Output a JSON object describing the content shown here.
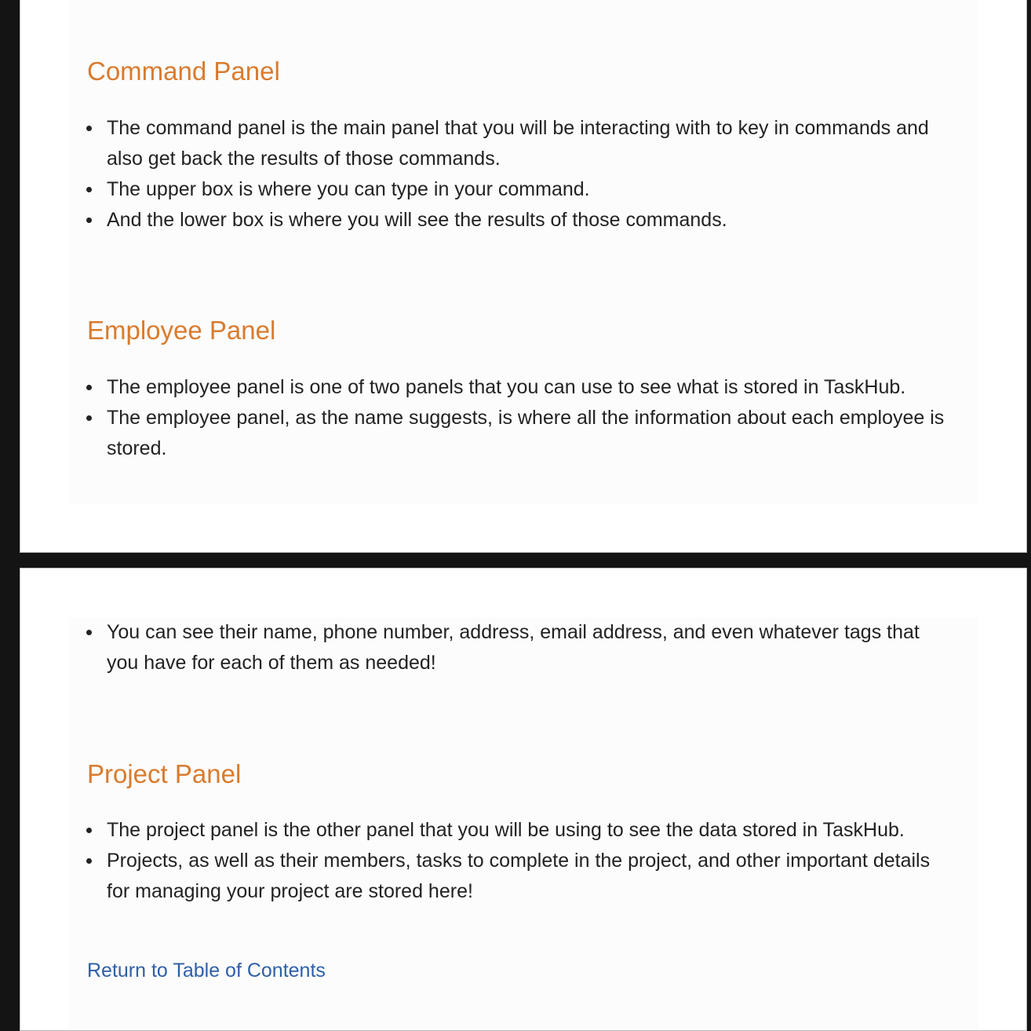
{
  "sections": {
    "command_panel": {
      "title": "Command Panel",
      "bullets": [
        "The command panel is the main panel that you will be interacting with to key in commands and also get back the results of those commands.",
        "The upper box is where you can type in your command.",
        "And the lower box is where you will see the results of those commands."
      ]
    },
    "employee_panel": {
      "title": "Employee Panel",
      "bullets": [
        "The employee panel is one of two panels that you can use to see what is stored in TaskHub.",
        "The employee panel, as the name suggests, is where all the information about each employee is stored.",
        "You can see their name, phone number, address, email address, and even whatever tags that you have for each of them as needed!"
      ]
    },
    "project_panel": {
      "title": "Project Panel",
      "bullets": [
        "The project panel is the other panel that you will be using to see the data stored in TaskHub.",
        "Projects, as well as their members, tasks to complete in the project, and other important details for managing your project are stored here!"
      ]
    }
  },
  "links": {
    "return_toc": "Return to Table of Contents"
  },
  "colors": {
    "heading": "#d97b2e",
    "link": "#2e5fa8",
    "page_background": "#141414",
    "content_background": "#fcfcfc"
  }
}
